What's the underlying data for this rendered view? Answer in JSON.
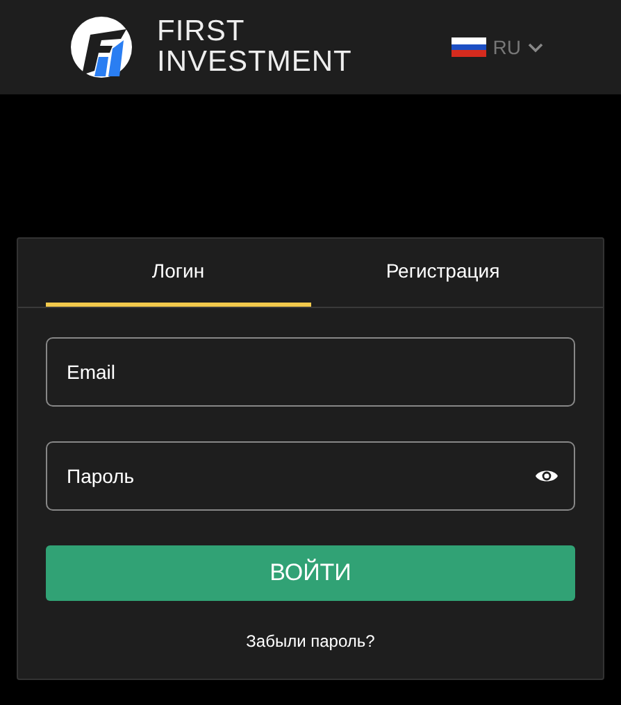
{
  "header": {
    "logo_line_1": "FIRST",
    "logo_line_2": "INVESTMENT",
    "language": "RU"
  },
  "tabs": [
    {
      "label": "Логин",
      "selected": true
    },
    {
      "label": "Регистрация",
      "selected": false
    }
  ],
  "fields": [
    {
      "placeholder": "Email",
      "kind": "text"
    },
    {
      "placeholder": "Пароль",
      "kind": "password"
    }
  ],
  "submit": "ВОЙТИ",
  "forgot_link": "Забыли пароль?"
}
